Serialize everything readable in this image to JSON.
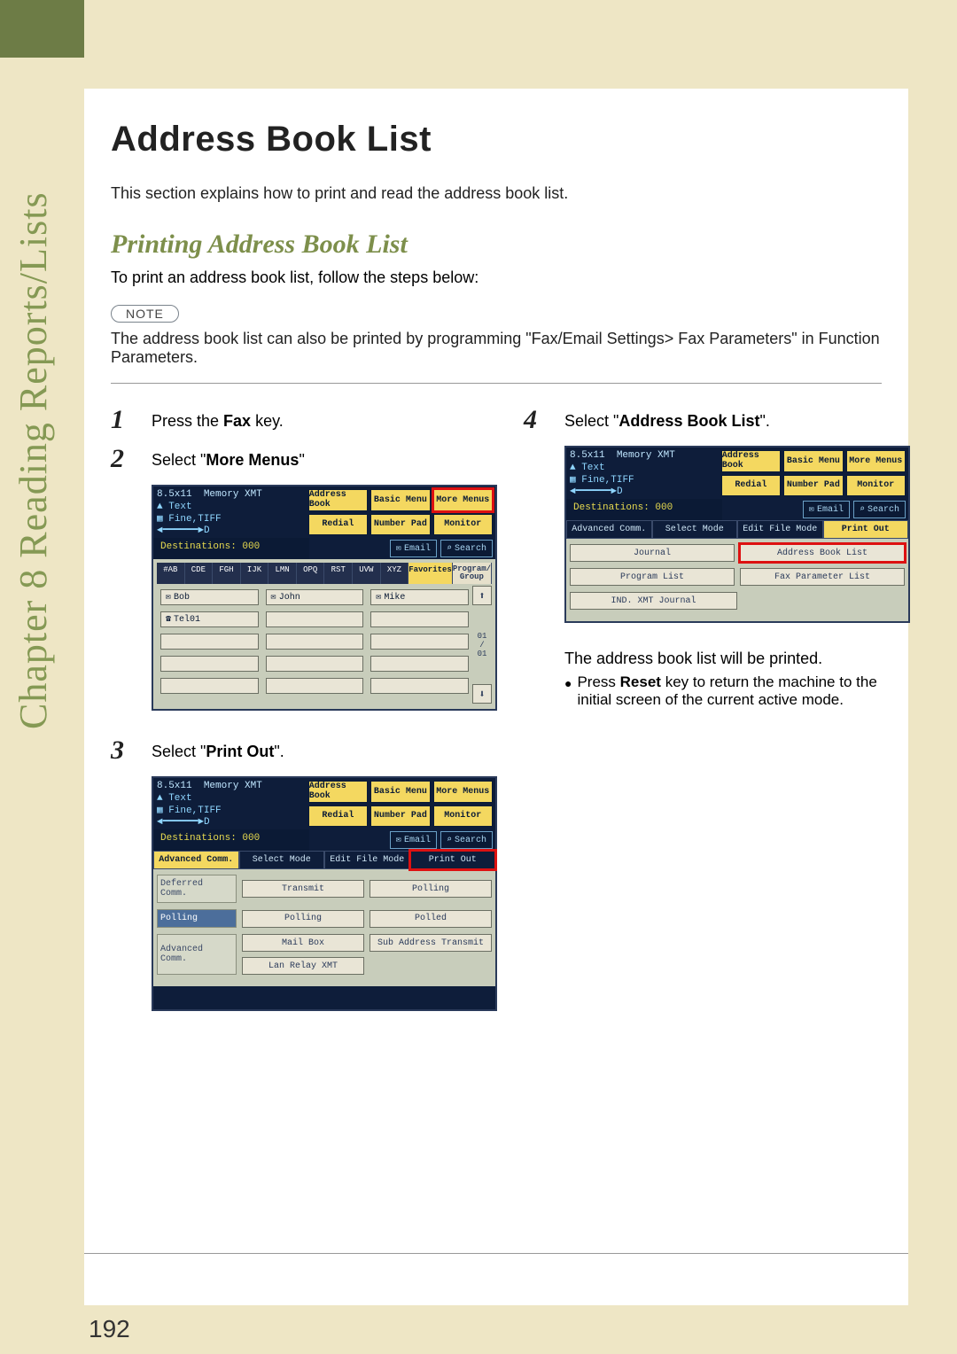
{
  "chapter": {
    "label": "Chapter 8  Reading Reports/Lists"
  },
  "page_number": "192",
  "title": "Address Book List",
  "intro": "This section explains how to print and read the address book list.",
  "subtitle": "Printing Address Book List",
  "sub_intro": "To print an address book list, follow the steps below:",
  "note": {
    "badge": "NOTE",
    "text": "The address book list can also be printed by programming \"Fax/Email Settings> Fax Parameters\" in Function Parameters."
  },
  "steps": {
    "s1": {
      "num": "1",
      "text_a": "Press the ",
      "bold": "Fax",
      "text_b": " key."
    },
    "s2": {
      "num": "2",
      "text_a": "Select \"",
      "bold": "More Menus",
      "text_b": "\""
    },
    "s3": {
      "num": "3",
      "text_a": "Select \"",
      "bold": "Print Out",
      "text_b": "\"."
    },
    "s4": {
      "num": "4",
      "text_a": "Select \"",
      "bold": "Address Book List",
      "text_b": "\"."
    }
  },
  "result_text": "The address book list will be printed.",
  "bullet": {
    "text_a": "Press ",
    "bold": "Reset",
    "text_b": " key to return the machine to the initial screen of the current active mode."
  },
  "screens": {
    "common": {
      "size": "8.5x11",
      "memory": "Memory XMT",
      "text": "Text",
      "fine": "Fine,TIFF",
      "destinations": "Destinations: 000",
      "hdr_btns": [
        "Address Book",
        "Basic Menu",
        "More Menus",
        "Redial",
        "Number Pad",
        "Monitor"
      ],
      "email": "Email",
      "search": "Search"
    },
    "s1": {
      "alpha": [
        "#AB",
        "CDE",
        "FGH",
        "IJK",
        "LMN",
        "OPQ",
        "RST",
        "UVW",
        "XYZ",
        "Favorites",
        "Program/\nGroup"
      ],
      "contacts": [
        "Bob",
        "John",
        "Mike",
        "Tel01"
      ]
    },
    "s2": {
      "tabs": [
        "Advanced Comm.",
        "Select Mode",
        "Edit File Mode",
        "Print Out"
      ],
      "rows": [
        {
          "label": "Deferred Comm.",
          "btns": [
            "Transmit",
            "Polling"
          ]
        },
        {
          "label": "Polling",
          "btns": [
            "Polling",
            "Polled"
          ]
        },
        {
          "label": "Advanced Comm.",
          "btns": [
            "Mail Box",
            "Sub Address Transmit"
          ]
        },
        {
          "label": "",
          "btns": [
            "Lan Relay XMT",
            ""
          ]
        }
      ]
    },
    "s3": {
      "tabs": [
        "Advanced Comm.",
        "Select Mode",
        "Edit File Mode",
        "Print Out"
      ],
      "row1": [
        "Journal",
        "Address Book List"
      ],
      "row2": [
        "Program List",
        "Fax Parameter List"
      ],
      "row3": [
        "IND. XMT Journal",
        ""
      ]
    }
  }
}
